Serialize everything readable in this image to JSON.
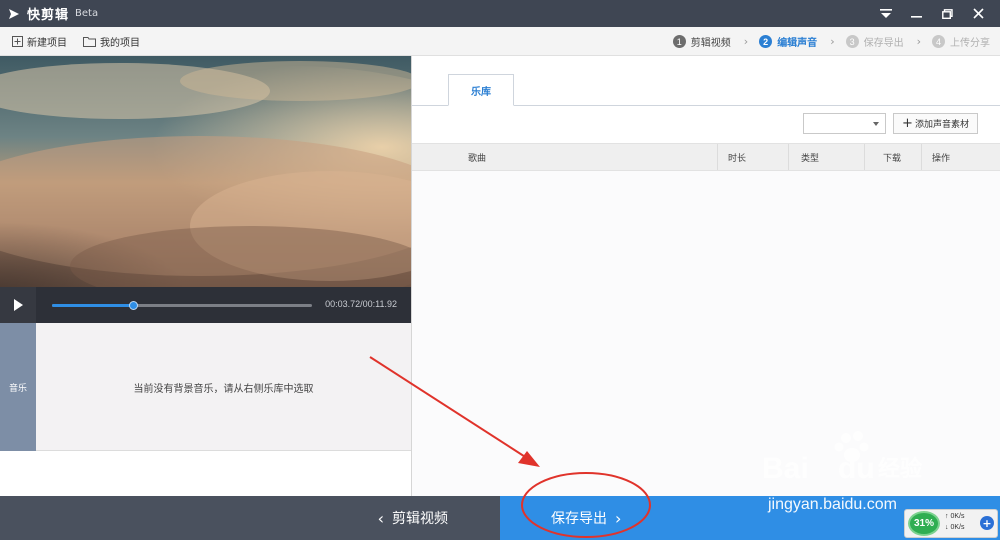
{
  "window": {
    "app_name": "快剪辑",
    "beta": "Beta"
  },
  "toolbar": {
    "new_project": "新建项目",
    "my_projects": "我的项目"
  },
  "steps": [
    {
      "num": "1",
      "label": "剪辑视频",
      "state": "done"
    },
    {
      "num": "2",
      "label": "编辑声音",
      "state": "active"
    },
    {
      "num": "3",
      "label": "保存导出",
      "state": "todo"
    },
    {
      "num": "4",
      "label": "上传分享",
      "state": "todo"
    }
  ],
  "player": {
    "time": "00:03.72/00:11.92",
    "progress": 0.31
  },
  "music": {
    "tag": "音乐",
    "empty_text": "当前没有背景音乐，请从右侧乐库中选取"
  },
  "library": {
    "tab": "乐库",
    "dropdown_value": "",
    "add_button": "添加声音素材",
    "columns": {
      "song": "歌曲",
      "duration": "时长",
      "type": "类型",
      "download": "下载",
      "action": "操作"
    }
  },
  "bottom": {
    "back_label": "剪辑视频",
    "next_label": "保存导出"
  },
  "watermark": {
    "brand": "Bai",
    "brand_tail": "du",
    "cn": "经验",
    "url": "jingyan.baidu.com"
  },
  "net_widget": {
    "percent": "31%",
    "up": "0K/s",
    "down": "0K/s"
  },
  "colors": {
    "accent": "#2f8ee5",
    "titlebar": "#3f4653",
    "annotation": "#e0332b"
  }
}
